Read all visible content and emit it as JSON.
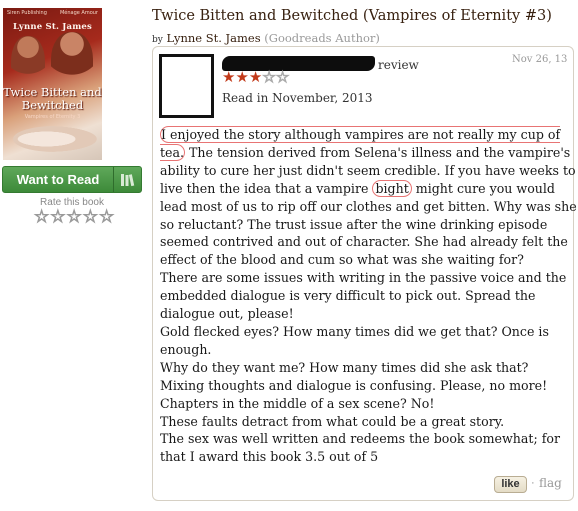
{
  "cover": {
    "publisher": "Siren Publishing",
    "imprint": "Ménage Amour",
    "author": "Lynne St. James",
    "title": "Twice Bitten and Bewitched",
    "series": "Vampires of Eternity 3"
  },
  "sidebar": {
    "want_to_read": "Want to Read",
    "rate_label": "Rate this book",
    "rate_stars": [
      "☆",
      "☆",
      "☆",
      "☆",
      "☆"
    ]
  },
  "book": {
    "title": "Twice Bitten and Bewitched (Vampires of Eternity #3)",
    "by": "by",
    "author": "Lynne St. James",
    "author_tag": "(Goodreads Author)"
  },
  "review": {
    "reviewer_suffix": "review",
    "rating": 3,
    "stars": [
      "★",
      "★",
      "★",
      "☆",
      "☆"
    ],
    "read_date": "Read in November, 2013",
    "date": "Nov 26, 13",
    "line1_a": "I enjoyed the story although vampires are not really my cup of",
    "line2_a": "tea.",
    "line2_b": " The tension derived from Selena's illness and the vampire's",
    "line3": "ability to cure her just didn't seem credible. If you have weeks to",
    "line4_a": "live then the idea that a vampire ",
    "line4_b": "bight",
    "line4_c": " might cure you would",
    "line5": "lead most of us to rip off our clothes and get bitten. Why was she",
    "line6": "so reluctant? The trust issue after the wine drinking episode",
    "line7": "seemed contrived and out of character. She had already felt the",
    "line8": "effect of the blood and cum so what was she waiting for?",
    "line9": "There are some issues with writing in the passive voice and the",
    "line10": "embedded dialogue is very difficult to pick out. Spread the",
    "line11": "dialogue out, please!",
    "line12": "Gold flecked eyes? How many times did we get that? Once is",
    "line13": "enough.",
    "line14": "Why do they want me? How many times did she ask that?",
    "line15": "Mixing thoughts and dialogue is confusing. Please, no more!",
    "line16": "Chapters in the middle of a sex scene? No!",
    "line17": "These faults detract from what could be a great story.",
    "line18": "The sex was well written and redeems the book somewhat; for",
    "line19": "that I award this book 3.5 out of 5",
    "like_label": "like",
    "separator": "·",
    "flag_label": "flag"
  },
  "colors": {
    "want_to_read_green": "#3d8a39",
    "title_brown": "#382110",
    "star_red": "#c23a1a",
    "annotation_red": "#e87474"
  }
}
